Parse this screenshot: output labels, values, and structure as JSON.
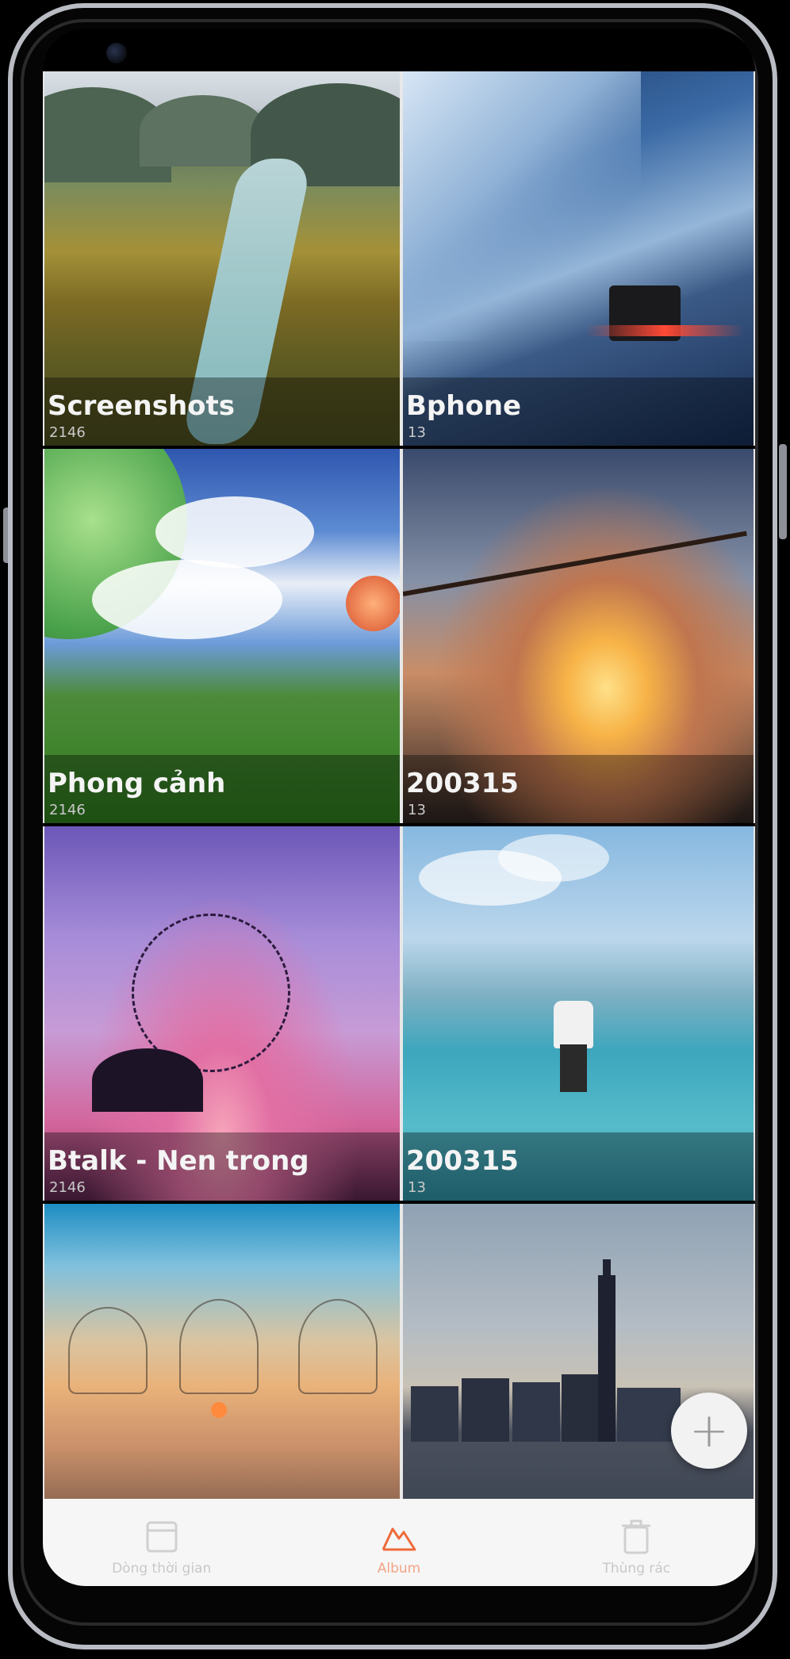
{
  "albums": [
    {
      "title": "Screenshots",
      "count": "2146"
    },
    {
      "title": "Bphone",
      "count": "13"
    },
    {
      "title": "Phong cảnh",
      "count": "2146"
    },
    {
      "title": "200315",
      "count": "13"
    },
    {
      "title": "Btalk - Nen trong",
      "count": "2146"
    },
    {
      "title": "200315",
      "count": "13"
    },
    {
      "title": "",
      "count": ""
    },
    {
      "title": "",
      "count": ""
    }
  ],
  "fab": {
    "label": "+"
  },
  "bottom_nav": {
    "items": [
      {
        "label": "Dòng thời gian",
        "icon": "timeline-icon",
        "active": false
      },
      {
        "label": "Album",
        "icon": "album-icon",
        "active": true
      },
      {
        "label": "Thùng rác",
        "icon": "trash-icon",
        "active": false
      }
    ]
  },
  "colors": {
    "accent": "#ee6b3a",
    "nav_background": "#f6f6f6",
    "inactive_icon": "#d0d0d0"
  }
}
